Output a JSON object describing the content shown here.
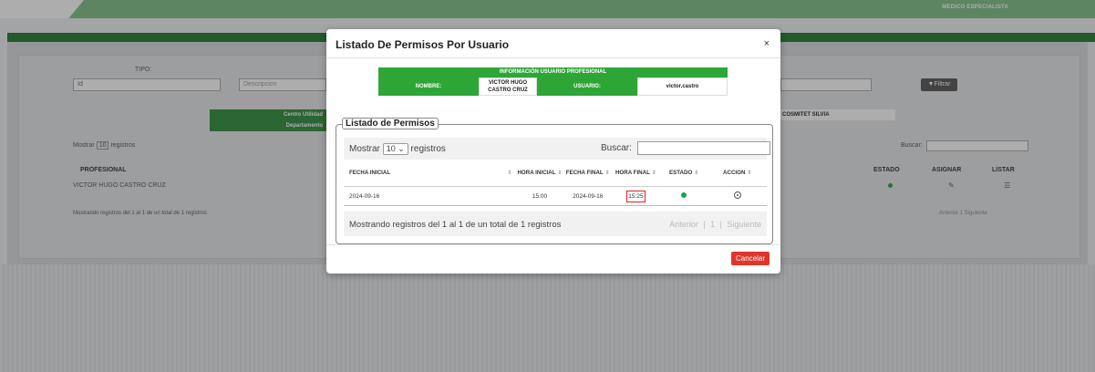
{
  "header": {
    "role": "MEDICO ESPECIALISTA"
  },
  "background": {
    "tipo_label": "TIPO:",
    "tipo_value": "Id",
    "descripcion_placeholder": "Descripcion",
    "filter_button": "Filtrar",
    "centro_label": "Centro Utilidad",
    "departamento_label": "Departamento",
    "centro_value": "COSMITET SILVIA",
    "show_prefix": "Mostrar",
    "show_value": "10",
    "show_suffix": "registros",
    "search_label": "Buscar:",
    "col_profesional": "PROFESIONAL",
    "col_estado": "ESTADO",
    "col_asignar": "ASIGNAR",
    "col_listar": "LISTAR",
    "row_profesional": "VICTOR HUGO CASTRO CRUZ",
    "footer_info": "Mostrando registros del 1 al 1 de un total de 1 registros",
    "pager": "Anterior  1  Siguiente"
  },
  "modal": {
    "title": "Listado De Permisos Por Usuario",
    "close": "×",
    "info_header": "INFORMACIÓN USUARIO PROFESIONAL",
    "nombre_label": "NOMBRE:",
    "nombre_value": "VICTOR HUGO CASTRO CRUZ",
    "usuario_label": "USUARIO:",
    "usuario_value": "victor.castro",
    "section_title": "Listado de Permisos",
    "show_prefix": "Mostrar",
    "show_value": "10",
    "show_suffix": "registros",
    "search_label": "Buscar:",
    "columns": [
      "FECHA INICIAL",
      "HORA INICIAL",
      "FECHA FINAL",
      "HORA FINAL",
      "ESTADO",
      "ACCION"
    ],
    "rows": [
      {
        "fecha_inicial": "2024-09-16",
        "hora_inicial": "15:00",
        "fecha_final": "2024-09-16",
        "hora_final": "15:25",
        "estado": "active",
        "accion": "view-icon"
      }
    ],
    "footer_info": "Mostrando registros del 1 al 1 de un total de 1 registros",
    "prev": "Anterior",
    "page": "1",
    "next": "Siguiente",
    "cancel_button": "Cancelar"
  },
  "colors": {
    "brand_green": "#2ea637",
    "cancel_red": "#e0352b",
    "status_active": "#1ea43a"
  }
}
